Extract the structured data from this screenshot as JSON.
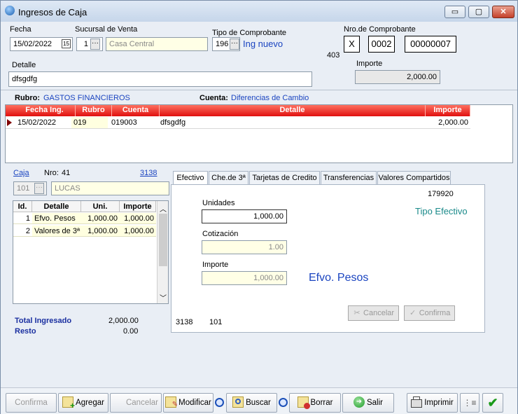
{
  "window": {
    "title": "Ingresos de Caja",
    "minimize": "▭",
    "maximize": "▢",
    "close": "✕"
  },
  "header": {
    "fecha_label": "Fecha",
    "fecha_value": "15/02/2022",
    "sucursal_label": "Sucursal de Venta",
    "sucursal_code": "1",
    "sucursal_name": "Casa Central",
    "tipo_label": "Tipo de Comprobante",
    "tipo_code": "196",
    "tipo_name": "Ing nuevo",
    "tipo_extra": "403",
    "nro_label": "Nro.de Comprobante",
    "nro_letter": "X",
    "nro_punto": "0002",
    "nro_numero": "00000007",
    "detalle_label": "Detalle",
    "detalle_value": "dfsgdfg",
    "importe_label": "Importe",
    "importe_value": "2,000.00"
  },
  "rubro_bar": {
    "rubro_label": "Rubro:",
    "rubro_value": "GASTOS FINANCIEROS",
    "cuenta_label": "Cuenta:",
    "cuenta_value": "Diferencias de Cambio"
  },
  "main_grid": {
    "columns": [
      "Fecha Ing.",
      "Rubro",
      "Cuenta",
      "Detalle",
      "Importe"
    ],
    "rows": [
      {
        "fecha": "15/02/2022",
        "rubro": "019",
        "cuenta": "019003",
        "detalle": "dfsgdfg",
        "importe": "2,000.00"
      }
    ]
  },
  "caja": {
    "caja_link": "Caja",
    "nro_label": "Nro:",
    "nro_value": "41",
    "code_link": "3138",
    "caja_code": "101",
    "caja_name": "LUCAS",
    "columns": [
      "Id.",
      "Detalle",
      "Uni.",
      "Importe"
    ],
    "rows": [
      {
        "id": "1",
        "detalle": "Efvo. Pesos",
        "uni": "1,000.00",
        "importe": "1,000.00"
      },
      {
        "id": "2",
        "detalle": "Valores de 3ª",
        "uni": "1,000.00",
        "importe": "1,000.00"
      }
    ],
    "total_label": "Total Ingresado",
    "total_value": "2,000.00",
    "resto_label": "Resto",
    "resto_value": "0.00"
  },
  "tabs": [
    "Efectivo",
    "Che.de 3ª",
    "Tarjetas de Credito",
    "Transferencias",
    "Valores Compartidos"
  ],
  "efectivo": {
    "code": "179920",
    "tipo": "Tipo Efectivo",
    "unidades_label": "Unidades",
    "unidades_value": "1,000.00",
    "cotizacion_label": "Cotización",
    "cotizacion_value": "1.00",
    "importe_label": "Importe",
    "importe_value": "1,000.00",
    "moneda": "Efvo. Pesos",
    "cancelar": "Cancelar",
    "confirma": "Confirma",
    "footer_code1": "3138",
    "footer_code2": "101"
  },
  "toolbar": {
    "confirma": "Confirma",
    "agregar": "Agregar",
    "cancelar": "Cancelar",
    "modificar": "Modificar",
    "buscar": "Buscar",
    "borrar": "Borrar",
    "salir": "Salir",
    "imprimir": "Imprimir"
  },
  "colors": {
    "grid_header": "#e01010",
    "link": "#1a44c0",
    "efvo_text": "#1a44c0",
    "tipo_efectivo": "#1a8a8a"
  }
}
